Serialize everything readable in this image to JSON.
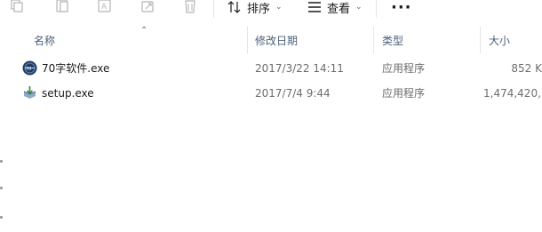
{
  "toolbar": {
    "icons": [
      "copy-icon",
      "paste-icon",
      "rename-icon",
      "share-icon",
      "delete-icon"
    ],
    "sort_label": "排序",
    "view_label": "查看",
    "more_label": "···"
  },
  "columns": {
    "name": "名称",
    "modified": "修改日期",
    "type": "类型",
    "size": "大小"
  },
  "files": [
    {
      "name": "70字软件.exe",
      "modified": "2017/3/22 14:11",
      "type": "应用程序",
      "size": "852 K",
      "icon": "app-globe-icon"
    },
    {
      "name": "setup.exe",
      "modified": "2017/7/4 9:44",
      "type": "应用程序",
      "size": "1,474,420,",
      "icon": "installer-icon"
    }
  ],
  "colors": {
    "header_text": "#4c607a",
    "meta_text": "#6d6d6d",
    "accent": "#1e6fd0"
  }
}
